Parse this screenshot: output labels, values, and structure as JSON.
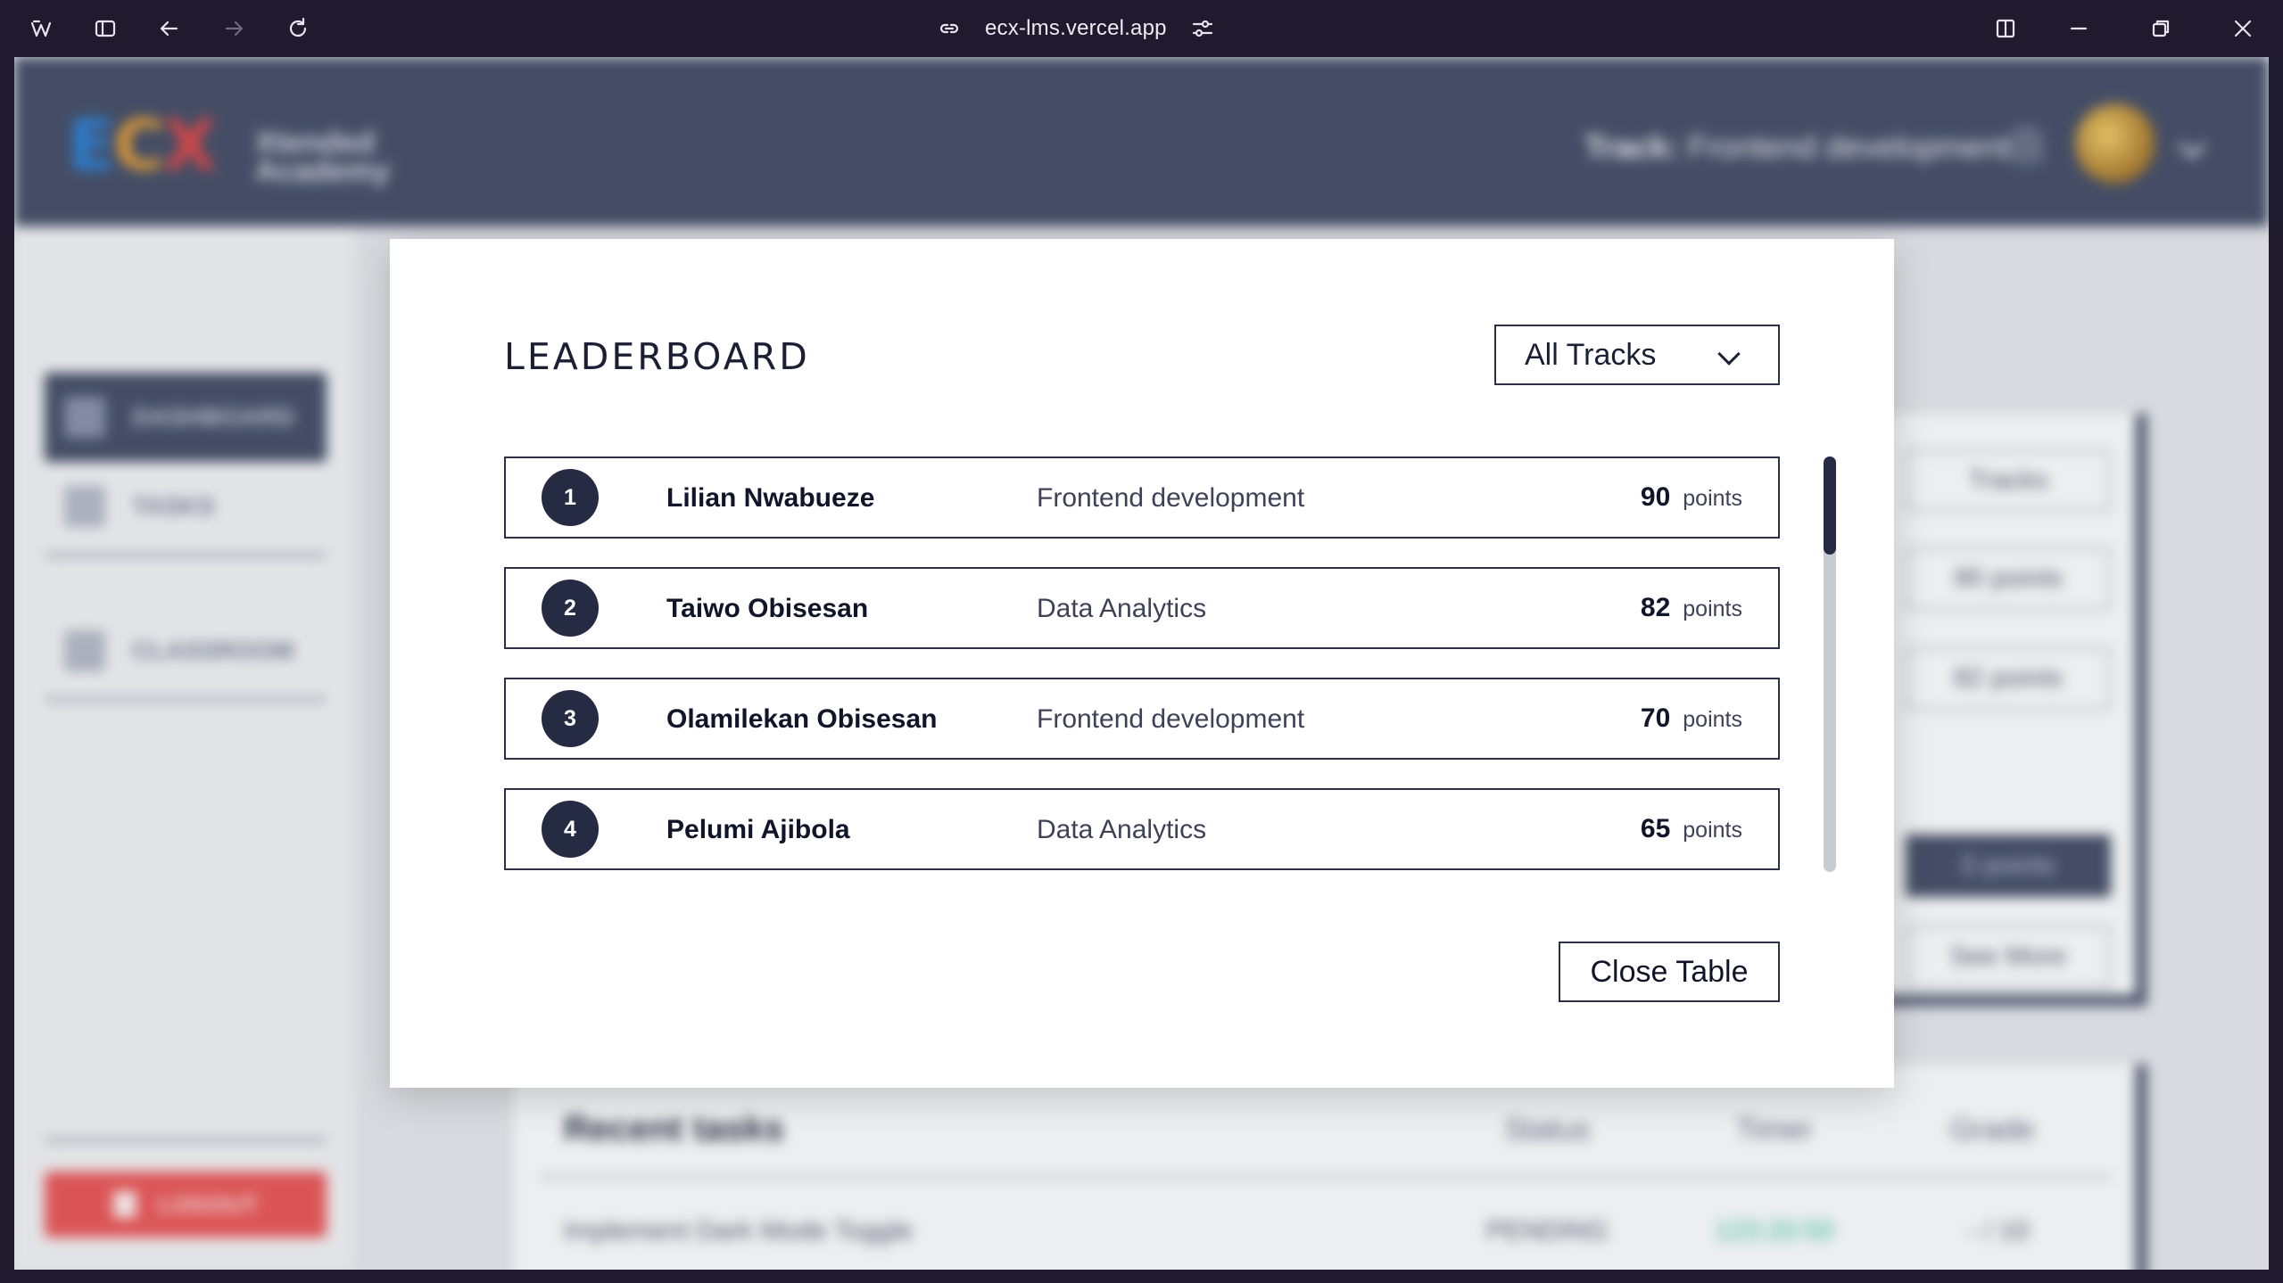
{
  "browser": {
    "url": "ecx-lms.vercel.app"
  },
  "background": {
    "logo": {
      "e": "E",
      "c": "C",
      "x": "X"
    },
    "logo_sub": "Xtended\nAcademy",
    "track_label": "Track:",
    "track_value": "Frontend development",
    "sidebar": [
      {
        "label": "DASHBOARD"
      },
      {
        "label": "TASKS"
      },
      {
        "label": "CLASSROOM"
      }
    ],
    "logout_label": "LOGOUT",
    "right_card": {
      "select": "Tracks",
      "points": [
        "90 points",
        "82 points",
        "0 points"
      ],
      "see_more": "See More"
    },
    "recent": {
      "title": "Recent tasks",
      "columns": [
        "Status",
        "Timer",
        "Grade"
      ],
      "row": {
        "task": "Implement Dark Mode Toggle",
        "status": "PENDING",
        "timer": "123:20:50",
        "grade": "- / 10"
      }
    }
  },
  "leaderboard": {
    "title": "LEADERBOARD",
    "filter": "All Tracks",
    "unit": "points",
    "entries": [
      {
        "rank": "1",
        "name": "Lilian Nwabueze",
        "track": "Frontend development",
        "points": "90"
      },
      {
        "rank": "2",
        "name": "Taiwo Obisesan",
        "track": "Data Analytics",
        "points": "82"
      },
      {
        "rank": "3",
        "name": "Olamilekan Obisesan",
        "track": "Frontend development",
        "points": "70"
      },
      {
        "rank": "4",
        "name": "Pelumi Ajibola",
        "track": "Data Analytics",
        "points": "65"
      }
    ],
    "close_label": "Close Table"
  }
}
